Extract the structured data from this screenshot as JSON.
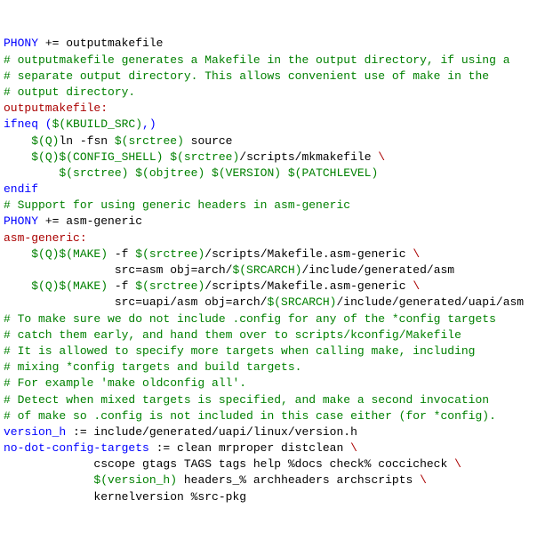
{
  "lines": [
    {
      "segments": [
        {
          "text": "PHONY",
          "cls": "blue"
        },
        {
          "text": " += outputmakefile",
          "cls": "black"
        }
      ]
    },
    {
      "segments": [
        {
          "text": "# outputmakefile generates a Makefile in the output directory, if using a",
          "cls": "green"
        }
      ]
    },
    {
      "segments": [
        {
          "text": "# separate output directory. This allows convenient use of make in the",
          "cls": "green"
        }
      ]
    },
    {
      "segments": [
        {
          "text": "# output directory.",
          "cls": "green"
        }
      ]
    },
    {
      "segments": [
        {
          "text": "outputmakefile:",
          "cls": "red"
        }
      ]
    },
    {
      "segments": [
        {
          "text": "ifneq (",
          "cls": "blue"
        },
        {
          "text": "$(KBUILD_SRC)",
          "cls": "green"
        },
        {
          "text": ",)",
          "cls": "blue"
        }
      ]
    },
    {
      "segments": [
        {
          "text": "    ",
          "cls": "black"
        },
        {
          "text": "$(Q)",
          "cls": "green"
        },
        {
          "text": "ln -fsn ",
          "cls": "black"
        },
        {
          "text": "$(srctree)",
          "cls": "green"
        },
        {
          "text": " source",
          "cls": "black"
        }
      ]
    },
    {
      "segments": [
        {
          "text": "    ",
          "cls": "black"
        },
        {
          "text": "$(Q)$(CONFIG_SHELL) $(srctree)",
          "cls": "green"
        },
        {
          "text": "/scripts/mkmakefile ",
          "cls": "black"
        },
        {
          "text": "\\",
          "cls": "red"
        }
      ]
    },
    {
      "segments": [
        {
          "text": "        ",
          "cls": "black"
        },
        {
          "text": "$(srctree) $(objtree) $(VERSION) $(PATCHLEVEL)",
          "cls": "green"
        }
      ]
    },
    {
      "segments": [
        {
          "text": "endif",
          "cls": "blue"
        }
      ]
    },
    {
      "segments": [
        {
          "text": "",
          "cls": "black"
        }
      ]
    },
    {
      "segments": [
        {
          "text": "# Support for using generic headers in asm-generic",
          "cls": "green"
        }
      ]
    },
    {
      "segments": [
        {
          "text": "PHONY",
          "cls": "blue"
        },
        {
          "text": " += asm-generic",
          "cls": "black"
        }
      ]
    },
    {
      "segments": [
        {
          "text": "asm-generic:",
          "cls": "red"
        }
      ]
    },
    {
      "segments": [
        {
          "text": "    ",
          "cls": "black"
        },
        {
          "text": "$(Q)$(MAKE)",
          "cls": "green"
        },
        {
          "text": " -f ",
          "cls": "black"
        },
        {
          "text": "$(srctree)",
          "cls": "green"
        },
        {
          "text": "/scripts/Makefile.asm-generic ",
          "cls": "black"
        },
        {
          "text": "\\",
          "cls": "red"
        }
      ]
    },
    {
      "segments": [
        {
          "text": "                src=asm obj=arch/",
          "cls": "black"
        },
        {
          "text": "$(SRCARCH)",
          "cls": "green"
        },
        {
          "text": "/include/generated/asm",
          "cls": "black"
        }
      ]
    },
    {
      "segments": [
        {
          "text": "    ",
          "cls": "black"
        },
        {
          "text": "$(Q)$(MAKE)",
          "cls": "green"
        },
        {
          "text": " -f ",
          "cls": "black"
        },
        {
          "text": "$(srctree)",
          "cls": "green"
        },
        {
          "text": "/scripts/Makefile.asm-generic ",
          "cls": "black"
        },
        {
          "text": "\\",
          "cls": "red"
        }
      ]
    },
    {
      "segments": [
        {
          "text": "                src=uapi/asm obj=arch/",
          "cls": "black"
        },
        {
          "text": "$(SRCARCH)",
          "cls": "green"
        },
        {
          "text": "/include/generated/uapi/asm",
          "cls": "black"
        }
      ]
    },
    {
      "segments": [
        {
          "text": "",
          "cls": "black"
        }
      ]
    },
    {
      "segments": [
        {
          "text": "# To make sure we do not include .config for any of the *config targets",
          "cls": "green"
        }
      ]
    },
    {
      "segments": [
        {
          "text": "# catch them early, and hand them over to scripts/kconfig/Makefile",
          "cls": "green"
        }
      ]
    },
    {
      "segments": [
        {
          "text": "# It is allowed to specify more targets when calling make, including",
          "cls": "green"
        }
      ]
    },
    {
      "segments": [
        {
          "text": "# mixing *config targets and build targets.",
          "cls": "green"
        }
      ]
    },
    {
      "segments": [
        {
          "text": "# For example 'make oldconfig all'.",
          "cls": "green"
        }
      ]
    },
    {
      "segments": [
        {
          "text": "# Detect when mixed targets is specified, and make a second invocation",
          "cls": "green"
        }
      ]
    },
    {
      "segments": [
        {
          "text": "# of make so .config is not included in this case either (for *config).",
          "cls": "green"
        }
      ]
    },
    {
      "segments": [
        {
          "text": "",
          "cls": "black"
        }
      ]
    },
    {
      "segments": [
        {
          "text": "version_h",
          "cls": "blue"
        },
        {
          "text": " := include/generated/uapi/linux/version.h",
          "cls": "black"
        }
      ]
    },
    {
      "segments": [
        {
          "text": "",
          "cls": "black"
        }
      ]
    },
    {
      "segments": [
        {
          "text": "no-dot-config-targets",
          "cls": "blue"
        },
        {
          "text": " := clean mrproper distclean ",
          "cls": "black"
        },
        {
          "text": "\\",
          "cls": "red"
        }
      ]
    },
    {
      "segments": [
        {
          "text": "             cscope gtags TAGS tags help %docs check% coccicheck ",
          "cls": "black"
        },
        {
          "text": "\\",
          "cls": "red"
        }
      ]
    },
    {
      "segments": [
        {
          "text": "             ",
          "cls": "black"
        },
        {
          "text": "$(version_h)",
          "cls": "green"
        },
        {
          "text": " headers_% archheaders archscripts ",
          "cls": "black"
        },
        {
          "text": "\\",
          "cls": "red"
        }
      ]
    },
    {
      "segments": [
        {
          "text": "             kernelversion %src-pkg",
          "cls": "black"
        }
      ]
    }
  ]
}
